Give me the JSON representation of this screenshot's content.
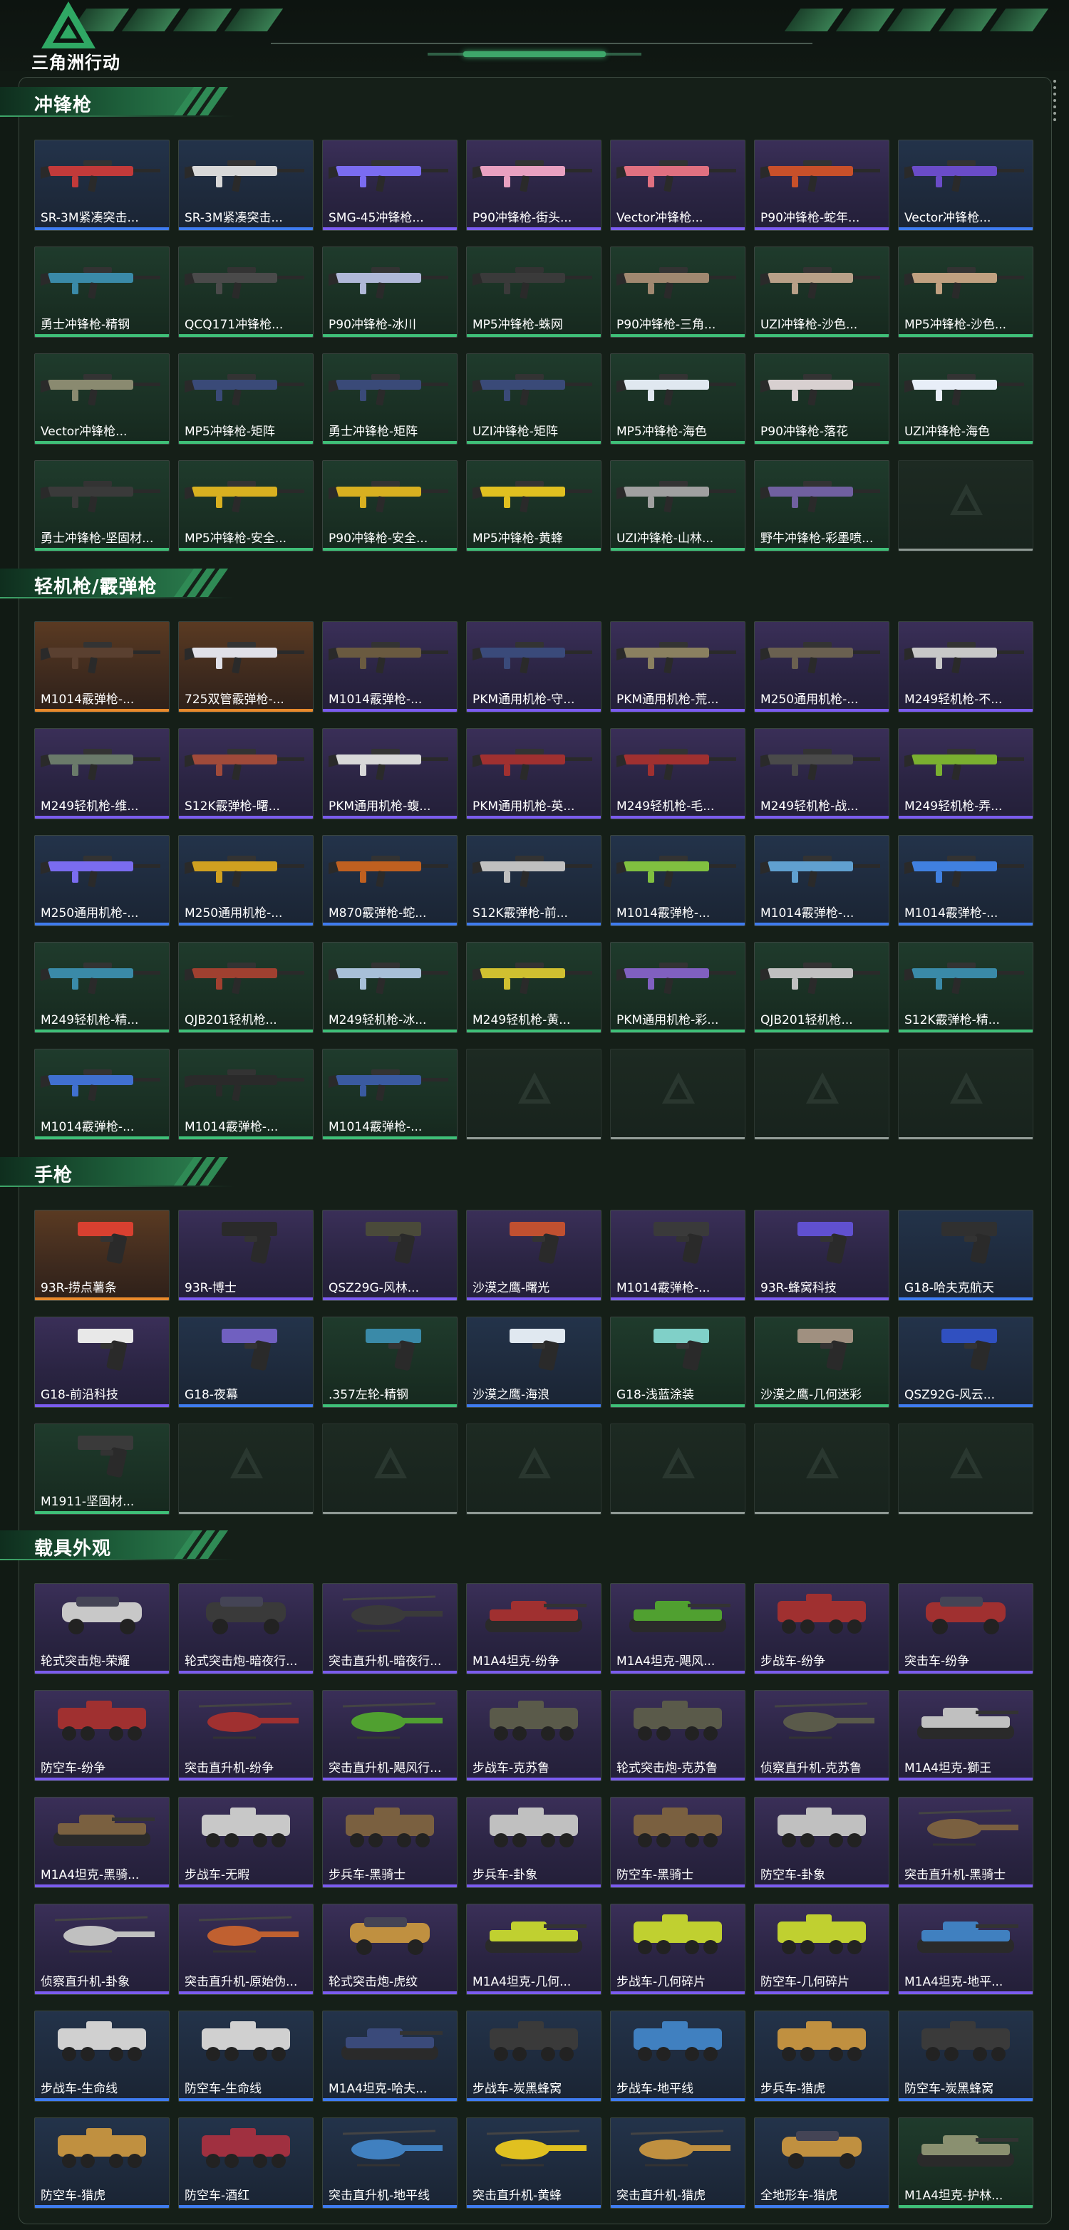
{
  "app": {
    "logo_text": "三角洲行动",
    "accent": "#3ea76a"
  },
  "quality_colors": {
    "purple": "#7b5cf0",
    "green": "#3fbf78",
    "gold": "#e88a2c",
    "blue": "#3f7cf0"
  },
  "sections": [
    {
      "title": "冲锋枪",
      "kind": "gun",
      "items": [
        {
          "label": "SR-3M紧凑突击...",
          "q": "blue",
          "c": "#c23a3a"
        },
        {
          "label": "SR-3M紧凑突击...",
          "q": "blue",
          "c": "#d8d8d8"
        },
        {
          "label": "SMG-45冲锋枪...",
          "q": "purple",
          "c": "#7a6cf0"
        },
        {
          "label": "P90冲锋枪-街头...",
          "q": "purple",
          "c": "#e8a0c0"
        },
        {
          "label": "Vector冲锋枪...",
          "q": "purple",
          "c": "#e07080"
        },
        {
          "label": "P90冲锋枪-蛇年...",
          "q": "purple",
          "c": "#c8502a"
        },
        {
          "label": "Vector冲锋枪...",
          "q": "blue",
          "c": "#6a4cc8"
        },
        {
          "label": "勇士冲锋枪-精钢",
          "q": "green",
          "c": "#3a8aa8"
        },
        {
          "label": "QCQ171冲锋枪...",
          "q": "green",
          "c": "#4a4a4a"
        },
        {
          "label": "P90冲锋枪-冰川",
          "q": "green",
          "c": "#b0b8d8"
        },
        {
          "label": "MP5冲锋枪-蛛网",
          "q": "green",
          "c": "#3a3a3a"
        },
        {
          "label": "P90冲锋枪-三角...",
          "q": "green",
          "c": "#a08870"
        },
        {
          "label": "UZI冲锋枪-沙色...",
          "q": "green",
          "c": "#b8a088"
        },
        {
          "label": "MP5冲锋枪-沙色...",
          "q": "green",
          "c": "#c0a080"
        },
        {
          "label": "Vector冲锋枪...",
          "q": "green",
          "c": "#8a8a70"
        },
        {
          "label": "MP5冲锋枪-矩阵",
          "q": "green",
          "c": "#3a4a78"
        },
        {
          "label": "勇士冲锋枪-矩阵",
          "q": "green",
          "c": "#3a4a78"
        },
        {
          "label": "UZI冲锋枪-矩阵",
          "q": "green",
          "c": "#3a4a78"
        },
        {
          "label": "MP5冲锋枪-海色",
          "q": "green",
          "c": "#e0e8f0"
        },
        {
          "label": "P90冲锋枪-落花",
          "q": "green",
          "c": "#d8d0d0"
        },
        {
          "label": "UZI冲锋枪-海色",
          "q": "green",
          "c": "#e8eef8"
        },
        {
          "label": "勇士冲锋枪-坚固材...",
          "q": "green",
          "c": "#3a3a3a"
        },
        {
          "label": "MP5冲锋枪-安全...",
          "q": "green",
          "c": "#d8b020"
        },
        {
          "label": "P90冲锋枪-安全...",
          "q": "green",
          "c": "#d8b020"
        },
        {
          "label": "MP5冲锋枪-黄蜂",
          "q": "green",
          "c": "#e0c020"
        },
        {
          "label": "UZI冲锋枪-山林...",
          "q": "green",
          "c": "#a0a0a0"
        },
        {
          "label": "野牛冲锋枪-彩墨喷...",
          "q": "green",
          "c": "#7060a0"
        },
        {
          "label": "",
          "q": "empty"
        }
      ]
    },
    {
      "title": "轻机枪/霰弹枪",
      "kind": "gun",
      "items": [
        {
          "label": "M1014霰弹枪-...",
          "q": "gold",
          "c": "#5a4030"
        },
        {
          "label": "725双管霰弹枪-...",
          "q": "gold",
          "c": "#e0e0e8"
        },
        {
          "label": "M1014霰弹枪-...",
          "q": "purple",
          "c": "#6a5a40"
        },
        {
          "label": "PKM通用机枪-守...",
          "q": "purple",
          "c": "#3a4a7a"
        },
        {
          "label": "PKM通用机枪-荒...",
          "q": "purple",
          "c": "#8a8060"
        },
        {
          "label": "M250通用机枪-...",
          "q": "purple",
          "c": "#6a6050"
        },
        {
          "label": "M249轻机枪-不...",
          "q": "purple",
          "c": "#c8c8c8"
        },
        {
          "label": "M249轻机枪-维...",
          "q": "purple",
          "c": "#6a7a6a"
        },
        {
          "label": "S12K霰弹枪-曙...",
          "q": "purple",
          "c": "#a04a3a"
        },
        {
          "label": "PKM通用机枪-蝮...",
          "q": "purple",
          "c": "#d8d8d8"
        },
        {
          "label": "PKM通用机枪-英...",
          "q": "purple",
          "c": "#a03030"
        },
        {
          "label": "M249轻机枪-毛...",
          "q": "purple",
          "c": "#a03030"
        },
        {
          "label": "M249轻机枪-战...",
          "q": "purple",
          "c": "#4a4a4a"
        },
        {
          "label": "M249轻机枪-弄...",
          "q": "purple",
          "c": "#7ab030"
        },
        {
          "label": "M250通用机枪-...",
          "q": "blue",
          "c": "#7a6cf0"
        },
        {
          "label": "M250通用机枪-...",
          "q": "blue",
          "c": "#d0a020"
        },
        {
          "label": "M870霰弹枪-蛇...",
          "q": "blue",
          "c": "#c06020"
        },
        {
          "label": "S12K霰弹枪-前...",
          "q": "blue",
          "c": "#c0c0c0"
        },
        {
          "label": "M1014霰弹枪-...",
          "q": "blue",
          "c": "#80c040"
        },
        {
          "label": "M1014霰弹枪-...",
          "q": "blue",
          "c": "#60a0d0"
        },
        {
          "label": "M1014霰弹枪-...",
          "q": "blue",
          "c": "#4080e0"
        },
        {
          "label": "M249轻机枪-精...",
          "q": "green",
          "c": "#3a8aa8"
        },
        {
          "label": "QJB201轻机枪...",
          "q": "green",
          "c": "#a04030"
        },
        {
          "label": "M249轻机枪-冰...",
          "q": "green",
          "c": "#a8c0d8"
        },
        {
          "label": "M249轻机枪-黄...",
          "q": "green",
          "c": "#d0c030"
        },
        {
          "label": "PKM通用机枪-彩...",
          "q": "green",
          "c": "#8060c0"
        },
        {
          "label": "QJB201轻机枪...",
          "q": "green",
          "c": "#c0c0c0"
        },
        {
          "label": "S12K霰弹枪-精...",
          "q": "green",
          "c": "#3a8aa8"
        },
        {
          "label": "M1014霰弹枪-...",
          "q": "green",
          "c": "#4070d0"
        },
        {
          "label": "M1014霰弹枪-...",
          "q": "green",
          "c": "#2a2a2a"
        },
        {
          "label": "M1014霰弹枪-...",
          "q": "green",
          "c": "#3a5aa0"
        },
        {
          "label": "",
          "q": "empty"
        },
        {
          "label": "",
          "q": "empty"
        },
        {
          "label": "",
          "q": "empty"
        },
        {
          "label": "",
          "q": "empty"
        }
      ]
    },
    {
      "title": "手枪",
      "kind": "pistol",
      "items": [
        {
          "label": "93R-捞点薯条",
          "q": "gold",
          "c": "#d84030"
        },
        {
          "label": "93R-博士",
          "q": "purple",
          "c": "#2a2a2a"
        },
        {
          "label": "QSZ29G-风林...",
          "q": "purple",
          "c": "#4a4a3a"
        },
        {
          "label": "沙漠之鹰-曙光",
          "q": "purple",
          "c": "#c05030"
        },
        {
          "label": "M1014霰弹枪-...",
          "q": "purple",
          "c": "#3a3a3a"
        },
        {
          "label": "93R-蜂窝科技",
          "q": "purple",
          "c": "#6050d0"
        },
        {
          "label": "G18-哈夫克航天",
          "q": "blue",
          "c": "#303030"
        },
        {
          "label": "G18-前沿科技",
          "q": "purple",
          "c": "#e8e8e8"
        },
        {
          "label": "G18-夜幕",
          "q": "blue",
          "c": "#7060c0"
        },
        {
          "label": ".357左轮-精钢",
          "q": "green",
          "c": "#3a8aa8"
        },
        {
          "label": "沙漠之鹰-海浪",
          "q": "blue",
          "c": "#e0e8f0"
        },
        {
          "label": "G18-浅蓝涂装",
          "q": "green",
          "c": "#80d0c8"
        },
        {
          "label": "沙漠之鹰-几何迷彩",
          "q": "green",
          "c": "#a09080"
        },
        {
          "label": "QSZ92G-风云...",
          "q": "blue",
          "c": "#3050c0"
        },
        {
          "label": "M1911-坚固材...",
          "q": "green",
          "c": "#3a3a3a"
        },
        {
          "label": "",
          "q": "empty"
        },
        {
          "label": "",
          "q": "empty"
        },
        {
          "label": "",
          "q": "empty"
        },
        {
          "label": "",
          "q": "empty"
        },
        {
          "label": "",
          "q": "empty"
        },
        {
          "label": "",
          "q": "empty"
        }
      ]
    },
    {
      "title": "载具外观",
      "kind": "vehicle",
      "items": [
        {
          "label": "轮式突击炮-荣耀",
          "q": "purple",
          "c": "#c8c8c8",
          "v": "car"
        },
        {
          "label": "轮式突击炮-暗夜行...",
          "q": "purple",
          "c": "#3a3a3a",
          "v": "car"
        },
        {
          "label": "突击直升机-暗夜行...",
          "q": "purple",
          "c": "#3a3a3a",
          "v": "heli"
        },
        {
          "label": "M1A4坦克-纷争",
          "q": "purple",
          "c": "#a03030",
          "v": "tank"
        },
        {
          "label": "M1A4坦克-飓风...",
          "q": "purple",
          "c": "#50a030",
          "v": "tank"
        },
        {
          "label": "步战车-纷争",
          "q": "purple",
          "c": "#a03030",
          "v": "apc"
        },
        {
          "label": "突击车-纷争",
          "q": "purple",
          "c": "#a03030",
          "v": "car"
        },
        {
          "label": "防空车-纷争",
          "q": "purple",
          "c": "#a03030",
          "v": "apc"
        },
        {
          "label": "突击直升机-纷争",
          "q": "purple",
          "c": "#a03030",
          "v": "heli"
        },
        {
          "label": "突击直升机-飓风行...",
          "q": "purple",
          "c": "#50a030",
          "v": "heli"
        },
        {
          "label": "步战车-克苏鲁",
          "q": "purple",
          "c": "#5a5a4a",
          "v": "apc"
        },
        {
          "label": "轮式突击炮-克苏鲁",
          "q": "purple",
          "c": "#5a5a4a",
          "v": "apc"
        },
        {
          "label": "侦察直升机-克苏鲁",
          "q": "purple",
          "c": "#5a5a4a",
          "v": "heli"
        },
        {
          "label": "M1A4坦克-獅王",
          "q": "purple",
          "c": "#c0c0c0",
          "v": "tank"
        },
        {
          "label": "M1A4坦克-黑骑...",
          "q": "purple",
          "c": "#7a6040",
          "v": "tank"
        },
        {
          "label": "步战车-无暇",
          "q": "purple",
          "c": "#c8c8c8",
          "v": "apc"
        },
        {
          "label": "步兵车-黑骑士",
          "q": "purple",
          "c": "#7a6040",
          "v": "apc"
        },
        {
          "label": "步兵车-卦象",
          "q": "purple",
          "c": "#c0c0c0",
          "v": "apc"
        },
        {
          "label": "防空车-黑骑士",
          "q": "purple",
          "c": "#7a6040",
          "v": "apc"
        },
        {
          "label": "防空车-卦象",
          "q": "purple",
          "c": "#c0c0c0",
          "v": "apc"
        },
        {
          "label": "突击直升机-黑骑士",
          "q": "purple",
          "c": "#7a6040",
          "v": "heli"
        },
        {
          "label": "侦察直升机-卦象",
          "q": "purple",
          "c": "#c0c0c0",
          "v": "heli"
        },
        {
          "label": "突击直升机-原始伪...",
          "q": "purple",
          "c": "#c06030",
          "v": "heli"
        },
        {
          "label": "轮式突击炮-虎纹",
          "q": "purple",
          "c": "#c09040",
          "v": "car"
        },
        {
          "label": "M1A4坦克-几何...",
          "q": "purple",
          "c": "#c0d030",
          "v": "tank"
        },
        {
          "label": "步战车-几何碎片",
          "q": "purple",
          "c": "#c0d030",
          "v": "apc"
        },
        {
          "label": "防空车-几何碎片",
          "q": "purple",
          "c": "#c0d030",
          "v": "apc"
        },
        {
          "label": "M1A4坦克-地平...",
          "q": "purple",
          "c": "#4080c0",
          "v": "tank"
        },
        {
          "label": "步战车-生命线",
          "q": "blue",
          "c": "#d0d0d0",
          "v": "apc"
        },
        {
          "label": "防空车-生命线",
          "q": "blue",
          "c": "#d0d0d0",
          "v": "apc"
        },
        {
          "label": "M1A4坦克-哈夫...",
          "q": "blue",
          "c": "#3a4a7a",
          "v": "tank"
        },
        {
          "label": "步战车-炭黑蜂窝",
          "q": "blue",
          "c": "#3a3a3a",
          "v": "apc"
        },
        {
          "label": "步战车-地平线",
          "q": "blue",
          "c": "#4080c0",
          "v": "apc"
        },
        {
          "label": "步兵车-猎虎",
          "q": "blue",
          "c": "#c09040",
          "v": "apc"
        },
        {
          "label": "防空车-炭黑蜂窝",
          "q": "blue",
          "c": "#3a3a3a",
          "v": "apc"
        },
        {
          "label": "防空车-猎虎",
          "q": "blue",
          "c": "#c09040",
          "v": "apc"
        },
        {
          "label": "防空车-酒红",
          "q": "blue",
          "c": "#a03040",
          "v": "apc"
        },
        {
          "label": "突击直升机-地平线",
          "q": "blue",
          "c": "#4080c0",
          "v": "heli"
        },
        {
          "label": "突击直升机-黄蜂",
          "q": "blue",
          "c": "#e0c020",
          "v": "heli"
        },
        {
          "label": "突击直升机-猎虎",
          "q": "blue",
          "c": "#c09040",
          "v": "heli"
        },
        {
          "label": "全地形车-猎虎",
          "q": "blue",
          "c": "#c09040",
          "v": "car"
        },
        {
          "label": "M1A4坦克-护林...",
          "q": "green",
          "c": "#8a9070",
          "v": "tank"
        }
      ]
    }
  ]
}
